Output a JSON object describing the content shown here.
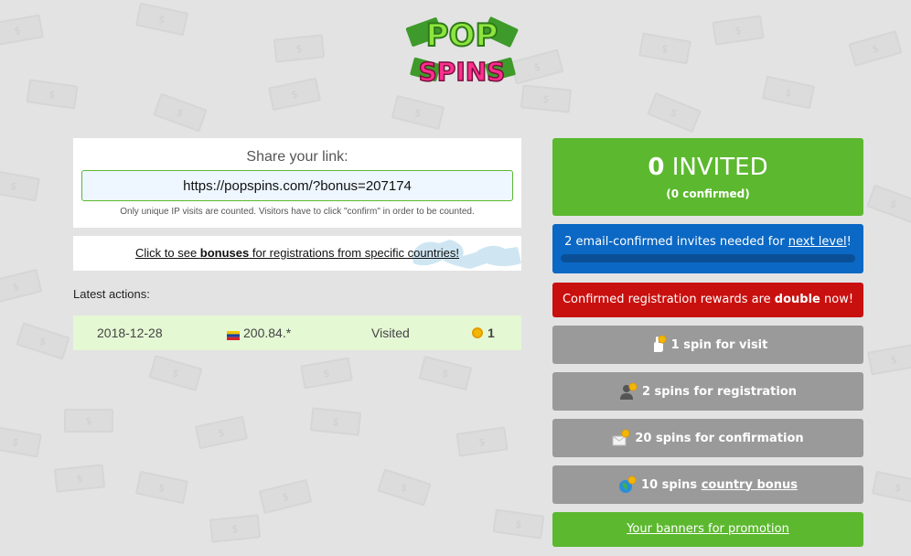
{
  "logo": {
    "line1": "POP",
    "line2": "SPINS"
  },
  "share": {
    "title": "Share your link:",
    "link": "https://popspins.com/?bonus=207174",
    "note": "Only unique IP visits are counted. Visitors have to click \"confirm\" in order to be counted."
  },
  "country_link": {
    "prefix": "Click to see ",
    "bold": "bonuses",
    "suffix": " for registrations from specific countries!"
  },
  "latest_actions": {
    "label": "Latest actions:",
    "rows": [
      {
        "date": "2018-12-28",
        "ip": "200.84.*",
        "status": "Visited",
        "spins": "1"
      }
    ]
  },
  "invited": {
    "count": "0",
    "label": "INVITED",
    "confirmed": "(0 confirmed)"
  },
  "level": {
    "text": "2 email-confirmed invites needed for ",
    "link": "next level",
    "suffix": "!",
    "progress": 0
  },
  "double_notice": {
    "prefix": "Confirmed registration rewards are ",
    "bold": "double",
    "suffix": " now!"
  },
  "rewards": {
    "visit": "1 spin for visit",
    "registration": "2 spins for registration",
    "confirmation": "20 spins for confirmation",
    "country_prefix": "10 spins ",
    "country_link": "country bonus"
  },
  "banners": {
    "label": "Your banners for promotion"
  },
  "colors": {
    "green": "#5cb82f",
    "blue": "#0b68c4",
    "red": "#c8100e",
    "grey": "#9a9a9a",
    "row_bg": "#e4f8d4"
  },
  "icons": {
    "visit": "hand-pointer-icon",
    "registration": "user-icon",
    "confirmation": "email-check-icon",
    "country": "globe-icon",
    "coin": "coin-icon",
    "flag": "venezuela-flag-icon"
  }
}
